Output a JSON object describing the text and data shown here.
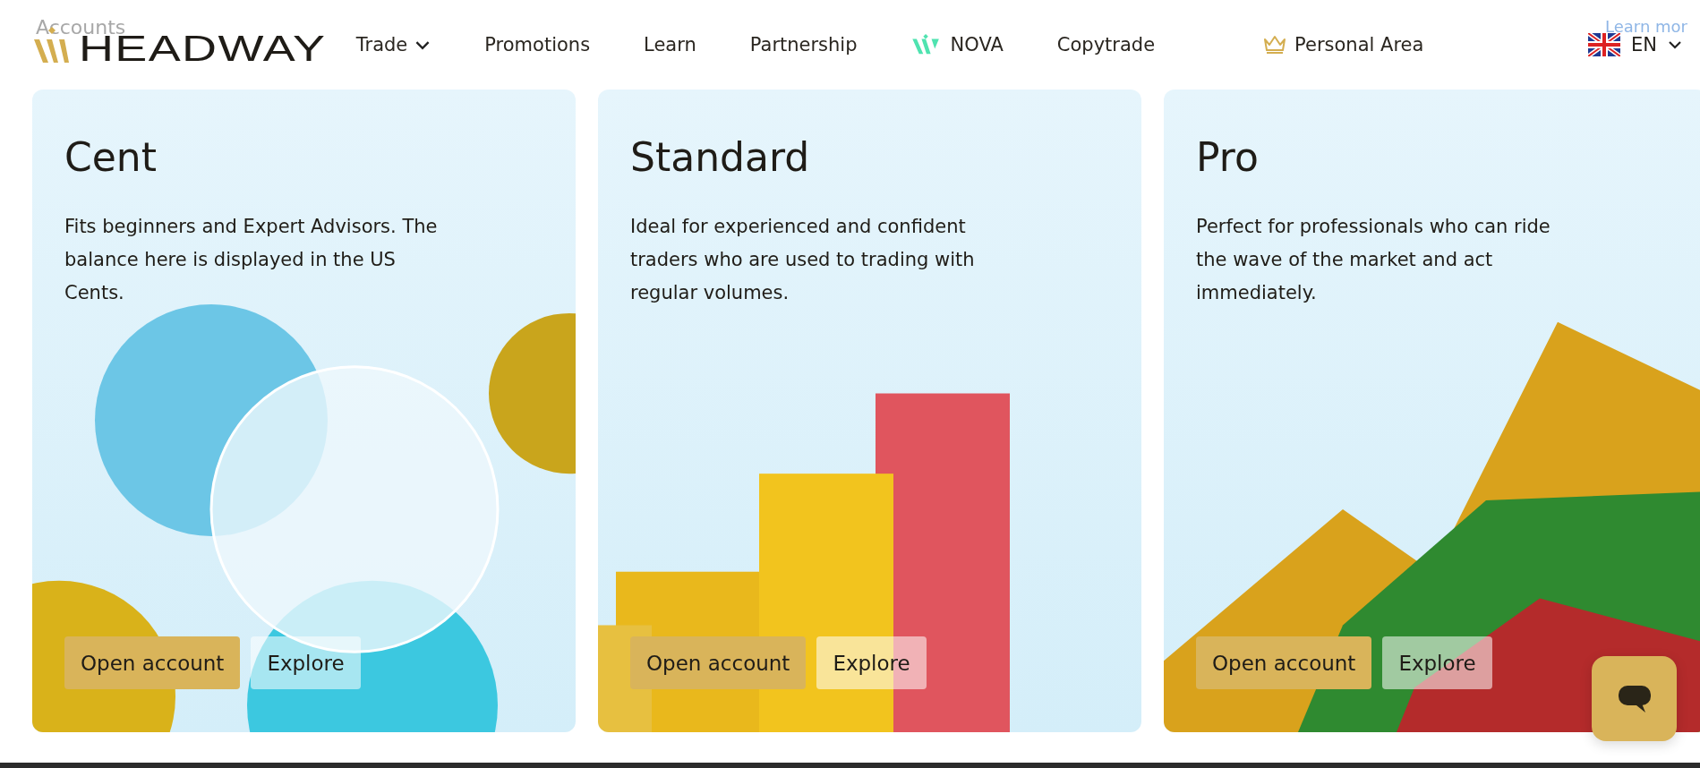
{
  "header": {
    "logo": "HEADWAY",
    "faded_left": "Accounts",
    "faded_right": "Learn mor",
    "nav": [
      {
        "label": "Trade",
        "kind": "menu"
      },
      {
        "label": "Promotions",
        "kind": "plain"
      },
      {
        "label": "Learn",
        "kind": "plain"
      },
      {
        "label": "Partnership",
        "kind": "plain"
      },
      {
        "label": "NOVA",
        "kind": "brand"
      },
      {
        "label": "Copytrade",
        "kind": "plain"
      },
      {
        "label": "Personal Area",
        "kind": "account"
      }
    ],
    "language": "EN"
  },
  "cards": [
    {
      "title": "Cent",
      "kind": "circles",
      "description": "Fits beginners and Expert Advisors. The balance here is displayed in the US Cents.",
      "buttons": [
        {
          "label": "Open account",
          "kind": "primary"
        },
        {
          "label": "Explore",
          "kind": "secondary"
        }
      ]
    },
    {
      "title": "Standard",
      "kind": "bars",
      "description": "Ideal for experienced and confident traders who are used to trading with regular volumes.",
      "buttons": [
        {
          "label": "Open account",
          "kind": "primary"
        },
        {
          "label": "Explore",
          "kind": "secondary"
        }
      ]
    },
    {
      "title": "Pro",
      "kind": "peak",
      "description": "Perfect for professionals who can ride the wave of the market and act immediately.",
      "buttons": [
        {
          "label": "Open account",
          "kind": "primary"
        },
        {
          "label": "Explore",
          "kind": "secondary"
        }
      ]
    }
  ]
}
